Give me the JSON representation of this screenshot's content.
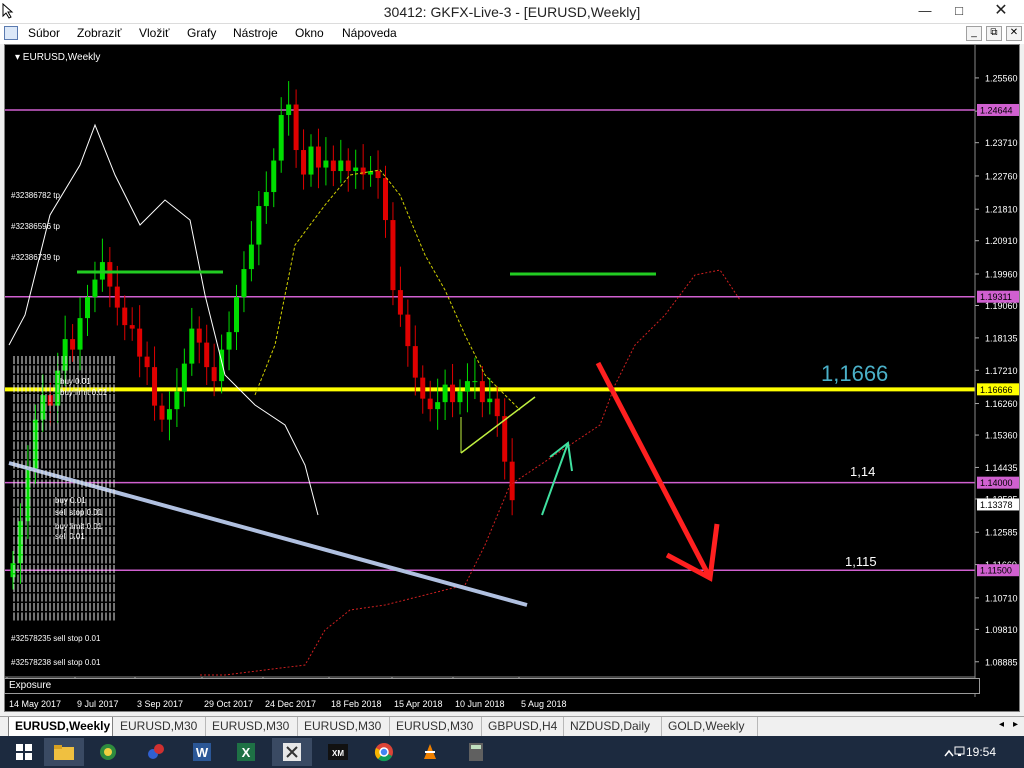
{
  "window": {
    "title": "30412: GKFX-Live-3 - [EURUSD,Weekly]",
    "minimize": "—",
    "maximize": "□",
    "close": "✕"
  },
  "menu": [
    "Súbor",
    "Zobraziť",
    "Vložiť",
    "Grafy",
    "Nástroje",
    "Okno",
    "Nápoveda"
  ],
  "mdi_controls": [
    "_",
    "⧉",
    "✕"
  ],
  "chart": {
    "symbol_label": "▾ EURUSD,Weekly",
    "price_axis": [
      "1.25560",
      "1.24610",
      "1.23710",
      "1.22760",
      "1.21810",
      "1.20910",
      "1.19960",
      "1.19060",
      "1.18135",
      "1.17210",
      "1.16260",
      "1.15360",
      "1.14435",
      "1.13535",
      "1.12585",
      "1.11660",
      "1.10710",
      "1.09810",
      "1.08885"
    ],
    "time_axis": [
      "14 May 2017",
      "9 Jul 2017",
      "3 Sep 2017",
      "29 Oct 2017",
      "24 Dec 2017",
      "18 Feb 2018",
      "15 Apr 2018",
      "10 Jun 2018",
      "5 Aug 2018"
    ],
    "hlines": [
      {
        "price": "1.24644",
        "color": "#d060d0"
      },
      {
        "price": "1.19311",
        "color": "#d060d0"
      },
      {
        "price": "1.16666",
        "color": "#ffff00"
      },
      {
        "price": "1.14000",
        "color": "#d060d0"
      },
      {
        "price": "1.13378",
        "color": "#ffffff"
      },
      {
        "price": "1.11500",
        "color": "#d060d0"
      }
    ],
    "annotations": {
      "level_1": "1,1666",
      "level_2": "1,14",
      "level_3": "1,115"
    },
    "order_labels": [
      "#32386782 tp",
      "#32386596 tp",
      "#32386739 tp",
      "#32578235 sell stop 0.01",
      "#32578238 sell stop 0.01"
    ],
    "order_stack_labels": [
      "buy 0.01",
      "buy limit 0.01",
      "sell 0.01",
      "sell stop 0.01"
    ],
    "exposure": "Exposure",
    "colors": {
      "bull": "#00dd00",
      "bear": "#e00000",
      "background": "#000000"
    }
  },
  "chart_data": {
    "type": "candlestick",
    "symbol": "EURUSD",
    "timeframe": "Weekly",
    "x": [
      "14 May 2017",
      "9 Jul 2017",
      "3 Sep 2017",
      "29 Oct 2017",
      "24 Dec 2017",
      "18 Feb 2018",
      "15 Apr 2018",
      "10 Jun 2018",
      "5 Aug 2018"
    ],
    "ylim": [
      1.0845,
      1.261
    ],
    "grid": false,
    "candles_close": [
      1.117,
      1.129,
      1.144,
      1.158,
      1.165,
      1.162,
      1.172,
      1.181,
      1.178,
      1.187,
      1.193,
      1.198,
      1.203,
      1.196,
      1.19,
      1.185,
      1.184,
      1.176,
      1.173,
      1.162,
      1.158,
      1.161,
      1.166,
      1.174,
      1.184,
      1.18,
      1.173,
      1.169,
      1.178,
      1.183,
      1.193,
      1.201,
      1.208,
      1.219,
      1.223,
      1.232,
      1.245,
      1.248,
      1.235,
      1.228,
      1.236,
      1.23,
      1.232,
      1.229,
      1.232,
      1.229,
      1.23,
      1.228,
      1.229,
      1.227,
      1.215,
      1.195,
      1.188,
      1.179,
      1.17,
      1.164,
      1.161,
      1.163,
      1.168,
      1.163,
      1.166,
      1.169,
      1.169,
      1.163,
      1.164,
      1.159,
      1.146,
      1.135
    ],
    "hlines": [
      1.24644,
      1.19311,
      1.16666,
      1.14,
      1.13378,
      1.115
    ],
    "annotations": [
      "1,1666",
      "1,14",
      "1,115"
    ]
  }
}
